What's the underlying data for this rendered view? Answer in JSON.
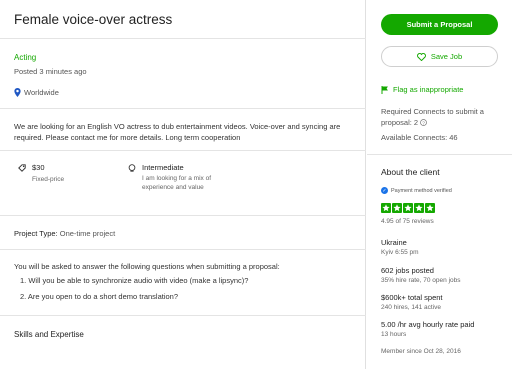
{
  "job": {
    "title": "Female voice-over actress",
    "category": "Acting",
    "posted": "Posted 3 minutes ago",
    "location": "Worldwide",
    "description": "We are looking for an English VO actress to dub entertainment videos.  Voice-over and syncing are required. Please contact me for more details. Long term cooperation",
    "budget_value": "$30",
    "budget_label": "Fixed-price",
    "level_value": "Intermediate",
    "level_desc": "I am looking for a mix of experience and value",
    "project_type_label": "Project Type:",
    "project_type_value": "One-time project",
    "questions_intro": "You will be asked to answer the following questions when submitting a proposal:",
    "questions": [
      "1. Will you be able to synchronize audio with video (make a lipsync)?",
      "2. Are you open to do a short demo translation?"
    ],
    "skills_heading": "Skills and Expertise"
  },
  "actions": {
    "submit_label": "Submit a Proposal",
    "save_label": "Save Job",
    "flag_label": "Flag as inappropriate",
    "connects_required": "Required Connects to submit a proposal: 2",
    "connects_available": "Available Connects: 46"
  },
  "client": {
    "heading": "About the client",
    "payment_verified": "Payment method verified",
    "rating_value": 4.95,
    "rating_text": "4.95 of 75 reviews",
    "country": "Ukraine",
    "city_time": "Kyiv 6:55 pm",
    "jobs_posted": "602 jobs posted",
    "hire_rate": "35% hire rate, 70 open jobs",
    "total_spent": "$600k+ total spent",
    "hires": "240 hires, 141 active",
    "hourly_rate": "5.00 /hr avg hourly rate paid",
    "hours": "13 hours",
    "member_since": "Member since Oct 28, 2016"
  },
  "colors": {
    "accent": "#14a800",
    "verified": "#1a73e8"
  },
  "icons": [
    "location-pin-icon",
    "price-tag-icon",
    "brain-icon",
    "heart-icon",
    "flag-icon",
    "verified-check-icon",
    "star-icon",
    "help-icon"
  ]
}
